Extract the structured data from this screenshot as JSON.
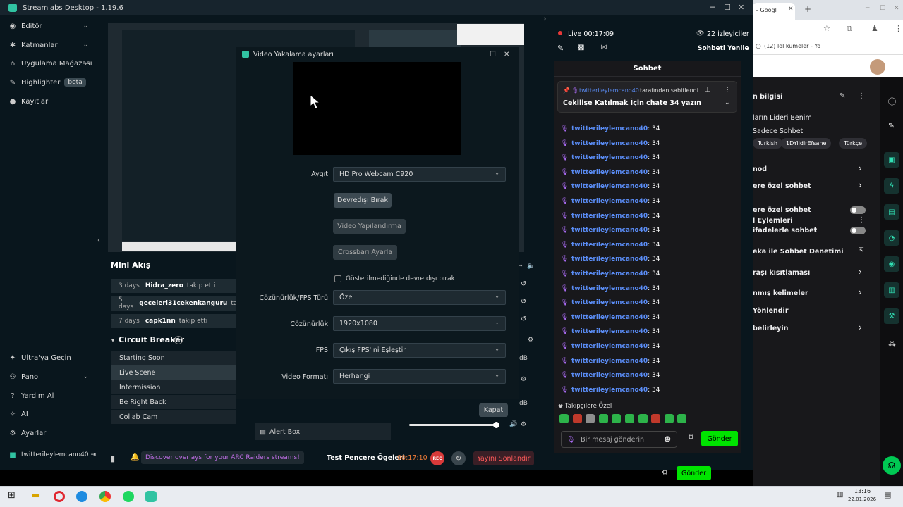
{
  "app": {
    "title": "Streamlabs Desktop - 1.19.6"
  },
  "sidebar": {
    "top_items": [
      {
        "label": "Editör",
        "icon": "editor-icon",
        "chevron": true
      },
      {
        "label": "Katmanlar",
        "icon": "layers-icon",
        "chevron": true
      },
      {
        "label": "Uygulama Mağazası",
        "icon": "store-icon",
        "chevron": true
      },
      {
        "label": "Highlighter",
        "icon": "highlighter-icon",
        "chevron": false
      },
      {
        "label": "Kayıtlar",
        "icon": "recordings-icon",
        "chevron": false
      }
    ],
    "highlighter_badge": "beta",
    "bottom_items": [
      {
        "label": "Ultra'ya Geçin",
        "icon": "ultra-icon"
      },
      {
        "label": "Pano",
        "icon": "dashboard-icon"
      },
      {
        "label": "Yardım Al",
        "icon": "help-icon"
      },
      {
        "label": "AI",
        "icon": "ai-icon"
      },
      {
        "label": "Ayarlar",
        "icon": "settings-icon"
      }
    ],
    "account": "twitterileylemcano40"
  },
  "mini_feed": {
    "title": "Mini Akış",
    "rows": [
      {
        "ago": "3 days",
        "name": "Hidra_zero",
        "action": "takip etti"
      },
      {
        "ago": "5 days",
        "name": "geceleri31cekenkanguru",
        "action": "takip"
      },
      {
        "ago": "7 days",
        "name": "capk1nn",
        "action": "takip etti"
      }
    ]
  },
  "scenes": {
    "title": "Circuit Breaker",
    "items": [
      "Starting Soon",
      "Live Scene",
      "Intermission",
      "Be Right Back",
      "Collab Cam"
    ],
    "active_index": 1
  },
  "sources": {
    "alert_box": "Alert Box"
  },
  "dialog": {
    "title": "Video Yakalama ayarları",
    "device_label": "Aygıt",
    "device_value": "HD Pro Webcam C920",
    "btn_deactivate": "Devredışı Bırak",
    "btn_video_config": "Video Yapılandırma",
    "btn_crossbar": "Crossbarı Ayarla",
    "checkbox_label": "Gösterilmediğinde devre dışı bırak",
    "res_type_label": "Çözünürlük/FPS Türü",
    "res_type_value": "Özel",
    "res_label": "Çözünürlük",
    "res_value": "1920x1080",
    "fps_label": "FPS",
    "fps_value": "Çıkış FPS'ini Eşleştir",
    "format_label": "Video Formatı",
    "format_value": "Herhangi",
    "close": "Kapat"
  },
  "mixer": {
    "db1": "dB",
    "db2": "dB"
  },
  "bottom": {
    "promo": "Discover overlays for your ARC Raiders streams!",
    "test_widgets": "Test Pencere Ögeleri",
    "timer": "00:17:10",
    "rec_label": "REC",
    "end_stream": "Yayını Sonlandır"
  },
  "live": {
    "status": "Live 00:17:09",
    "viewers": "22 izleyiciler",
    "refresh_chat": "Sohbeti Yenile"
  },
  "chat": {
    "title": "Sohbet",
    "pinned_by_user": "twitterileylemcano40",
    "pinned_by_suffix": "tarafından sabitlendi",
    "pinned_text": "Çekilişe Katılmak İçin chate 34 yazın",
    "messages": [
      {
        "user": "twitterileylemcano40",
        "text": ": 34"
      },
      {
        "user": "twitterileylemcano40",
        "text": ": 34"
      },
      {
        "user": "twitterileylemcano40",
        "text": ": 34"
      },
      {
        "user": "twitterileylemcano40",
        "text": ": 34"
      },
      {
        "user": "twitterileylemcano40",
        "text": ": 34"
      },
      {
        "user": "twitterileylemcano40",
        "text": ": 34"
      },
      {
        "user": "twitterileylemcano40",
        "text": ": 34"
      },
      {
        "user": "twitterileylemcano40",
        "text": ": 34"
      },
      {
        "user": "twitterileylemcano40",
        "text": ": 34"
      },
      {
        "user": "twitterileylemcano40",
        "text": ": 34"
      },
      {
        "user": "twitterileylemcano40",
        "text": ": 34"
      },
      {
        "user": "twitterileylemcano40",
        "text": ": 34"
      },
      {
        "user": "twitterileylemcano40",
        "text": ": 34"
      },
      {
        "user": "twitterileylemcano40",
        "text": ": 34"
      },
      {
        "user": "twitterileylemcano40",
        "text": ": 34"
      },
      {
        "user": "twitterileylemcano40",
        "text": ": 34"
      },
      {
        "user": "twitterileylemcano40",
        "text": ": 34"
      },
      {
        "user": "twitterileylemcano40",
        "text": ": 34"
      },
      {
        "user": "twitterileylemcano40",
        "text": ": 34"
      }
    ],
    "followers_only": "Takipçilere Özel",
    "placeholder": "Bir mesaj gönderin",
    "send": "Gönder",
    "send_outer": "Gönder"
  },
  "browser": {
    "tab1": "– Googl",
    "tab2": "(12) lol kümeler - Yo",
    "panel_title": "n bilgisi",
    "channel_line1": "ların Lideri Benim",
    "channel_line2": "Sadece Sohbet",
    "tags": [
      "Turkish",
      "1DYildirEfsane",
      "Türkçe"
    ],
    "actions_title": "l Eylemleri",
    "actions": [
      {
        "label": "nod",
        "control": "chevron"
      },
      {
        "label": "ere özel sohbet",
        "control": "chevron"
      },
      {
        "label": "ere özel sohbet",
        "control": "toggle"
      },
      {
        "label": "ifadelerle sohbet",
        "control": "toggle"
      },
      {
        "label": "eka ile Sohbet Denetimi",
        "control": "external"
      },
      {
        "label": "raşı kısıtlaması",
        "control": "chevron"
      },
      {
        "label": "nmış kelimeler",
        "control": "chevron"
      },
      {
        "label": "Yönlendir",
        "control": "none"
      },
      {
        "label": "belirleyin",
        "control": "chevron"
      }
    ]
  },
  "taskbar": {
    "time": "13:16",
    "date": "22.01.2026"
  },
  "colors": {
    "accent": "#31c3a2",
    "chat_green": "#00e400",
    "twitch_blue": "#5a8cf5",
    "badge_purple": "#a86af0",
    "live_red": "#d93a3a"
  }
}
